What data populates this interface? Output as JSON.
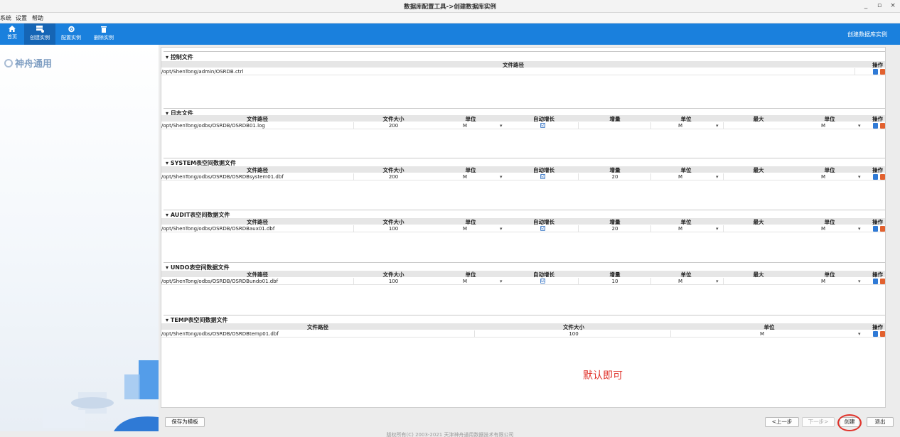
{
  "window": {
    "title": "数据库配置工具->创建数据库实例",
    "controls": [
      "_",
      "▫",
      "×"
    ]
  },
  "menu": [
    "系统",
    "设置",
    "帮助"
  ],
  "toolbar": {
    "buttons": [
      {
        "label": "首页",
        "icon": "home-icon"
      },
      {
        "label": "创建实例",
        "icon": "create-instance-icon"
      },
      {
        "label": "配置实例",
        "icon": "configure-gear-icon"
      },
      {
        "label": "删除实例",
        "icon": "trash-icon"
      }
    ],
    "right_text": "创建数据库实例",
    "color": "#1a80dd"
  },
  "sidebar": {
    "logo_text": "神舟通用"
  },
  "sections": {
    "control": {
      "title": "控制文件",
      "headers": [
        "文件路径",
        "操作"
      ],
      "rows": [
        {
          "path": "/opt/ShenTong/admin/OSRDB.ctrl"
        }
      ]
    },
    "log": {
      "title": "日志文件",
      "headers": [
        "文件路径",
        "文件大小",
        "单位",
        "自动增长",
        "增量",
        "单位",
        "最大",
        "单位",
        "操作"
      ],
      "rows": [
        {
          "path": "/opt/ShenTong/odbs/OSRDB/OSRDB01.log",
          "size": "200",
          "unit": "M",
          "auto": "☑",
          "inc": "",
          "inc_unit": "M",
          "max": "",
          "max_unit": "M"
        }
      ]
    },
    "system": {
      "title": "SYSTEM表空间数据文件",
      "headers": [
        "文件路径",
        "文件大小",
        "单位",
        "自动增长",
        "增量",
        "单位",
        "最大",
        "单位",
        "操作"
      ],
      "rows": [
        {
          "path": "/opt/ShenTong/odbs/OSRDB/OSRDBsystem01.dbf",
          "size": "200",
          "unit": "M",
          "auto": "☑",
          "inc": "20",
          "inc_unit": "M",
          "max": "",
          "max_unit": "M"
        }
      ]
    },
    "audit": {
      "title": "AUDIT表空间数据文件",
      "headers": [
        "文件路径",
        "文件大小",
        "单位",
        "自动增长",
        "增量",
        "单位",
        "最大",
        "单位",
        "操作"
      ],
      "rows": [
        {
          "path": "/opt/ShenTong/odbs/OSRDB/OSRDBaux01.dbf",
          "size": "100",
          "unit": "M",
          "auto": "☑",
          "inc": "20",
          "inc_unit": "M",
          "max": "",
          "max_unit": "M"
        }
      ]
    },
    "undo": {
      "title": "UNDO表空间数据文件",
      "headers": [
        "文件路径",
        "文件大小",
        "单位",
        "自动增长",
        "增量",
        "单位",
        "最大",
        "单位",
        "操作"
      ],
      "rows": [
        {
          "path": "/opt/ShenTong/odbs/OSRDB/OSRDBundo01.dbf",
          "size": "100",
          "unit": "M",
          "auto": "☑",
          "inc": "10",
          "inc_unit": "M",
          "max": "",
          "max_unit": "M"
        }
      ]
    },
    "temp": {
      "title": "TEMP表空间数据文件",
      "headers": [
        "文件路径",
        "文件大小",
        "单位",
        "操作"
      ],
      "rows": [
        {
          "path": "/opt/ShenTong/odbs/OSRDB/OSRDBtemp01.dbf",
          "size": "100",
          "unit": "M"
        }
      ]
    }
  },
  "annotation": "默认即可",
  "buttons": {
    "save_template": "保存为模板",
    "prev": "<上一步",
    "next": "下一步>",
    "create": "创建",
    "exit": "退出"
  },
  "footer": "版权所有(C) 2003-2021 天津神舟通用数据技术有限公司",
  "colors": {
    "accent": "#1a80dd",
    "annotation": "#e0322a"
  }
}
